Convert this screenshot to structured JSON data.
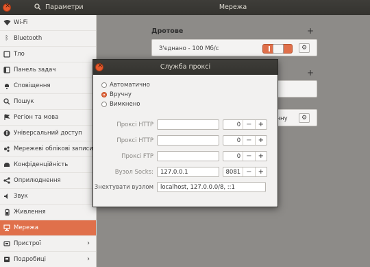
{
  "window": {
    "left_title": "Параметри",
    "center_title": "Мережа"
  },
  "sidebar": {
    "items": [
      {
        "label": "Wi-Fi",
        "icon": "wifi-icon"
      },
      {
        "label": "Bluetooth",
        "icon": "bluetooth-icon"
      },
      {
        "label": "Тло",
        "icon": "background-icon"
      },
      {
        "label": "Панель задач",
        "icon": "dock-icon"
      },
      {
        "label": "Сповіщення",
        "icon": "notifications-icon"
      },
      {
        "label": "Пошук",
        "icon": "search-icon"
      },
      {
        "label": "Регіон та мова",
        "icon": "region-icon"
      },
      {
        "label": "Універсальний доступ",
        "icon": "accessibility-icon"
      },
      {
        "label": "Мережеві облікові записи",
        "icon": "online-accounts-icon"
      },
      {
        "label": "Конфіденційність",
        "icon": "privacy-icon"
      },
      {
        "label": "Оприлюднення",
        "icon": "sharing-icon"
      },
      {
        "label": "Звук",
        "icon": "sound-icon"
      },
      {
        "label": "Живлення",
        "icon": "power-icon"
      },
      {
        "label": "Мережа",
        "icon": "network-icon",
        "active": true
      },
      {
        "label": "Пристрої",
        "icon": "devices-icon",
        "chevron": true
      },
      {
        "label": "Подробиці",
        "icon": "details-icon",
        "chevron": true
      }
    ]
  },
  "main": {
    "wired_title": "Дротове",
    "wired_status": "З'єднано - 100 Мб/с",
    "partial_text": "чну"
  },
  "dialog": {
    "title": "Служба проксі",
    "radios": [
      {
        "label": "Автоматично",
        "checked": false
      },
      {
        "label": "Вручну",
        "checked": true
      },
      {
        "label": "Вимкнено",
        "checked": false
      }
    ],
    "rows": [
      {
        "label": "Проксі HTTP",
        "value": "",
        "port": "0"
      },
      {
        "label": "Проксі HTTP",
        "value": "",
        "port": "0"
      },
      {
        "label": "Проксі FTP",
        "value": "",
        "port": "0"
      },
      {
        "label": "Вузол Socks:",
        "value": "127.0.0.1",
        "port": "8081"
      }
    ],
    "ignore_label": "Знехтувати вузлом",
    "ignore_value": "localhost, 127.0.0.0/8, ::1"
  },
  "colors": {
    "accent": "#e0704b",
    "titlebar": "#3a3935"
  }
}
